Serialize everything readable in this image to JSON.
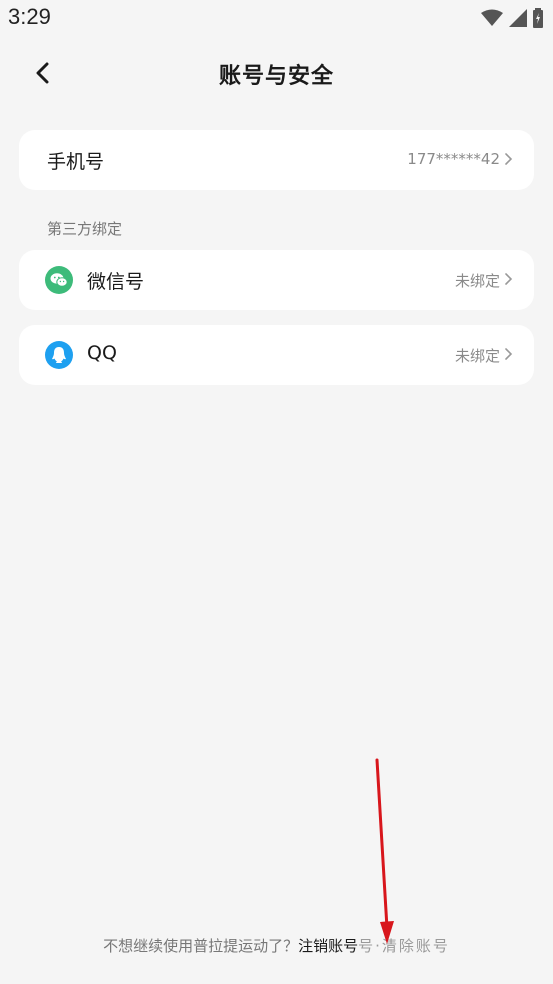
{
  "status_bar": {
    "time": "3:29",
    "icons": [
      "wifi-icon",
      "signal-icon",
      "battery-charging-icon"
    ]
  },
  "header": {
    "back_icon": "back-arrow-icon",
    "title": "账号与安全"
  },
  "phone_row": {
    "label": "手机号",
    "value": "177******42"
  },
  "third_party": {
    "section_title": "第三方绑定",
    "items": [
      {
        "label": "微信号",
        "value": "未绑定",
        "icon": "wechat-icon",
        "color": "#3dbb7a"
      },
      {
        "label": "QQ",
        "value": "未绑定",
        "icon": "qq-icon",
        "color": "#1ea0f0"
      }
    ]
  },
  "footer": {
    "prompt": "不想继续使用普拉提运动了？",
    "link": "注销账号",
    "link_tail": "号·清除账号"
  },
  "colors": {
    "background": "#f5f5f5",
    "card": "#ffffff",
    "annotation_arrow": "#d8161c"
  }
}
